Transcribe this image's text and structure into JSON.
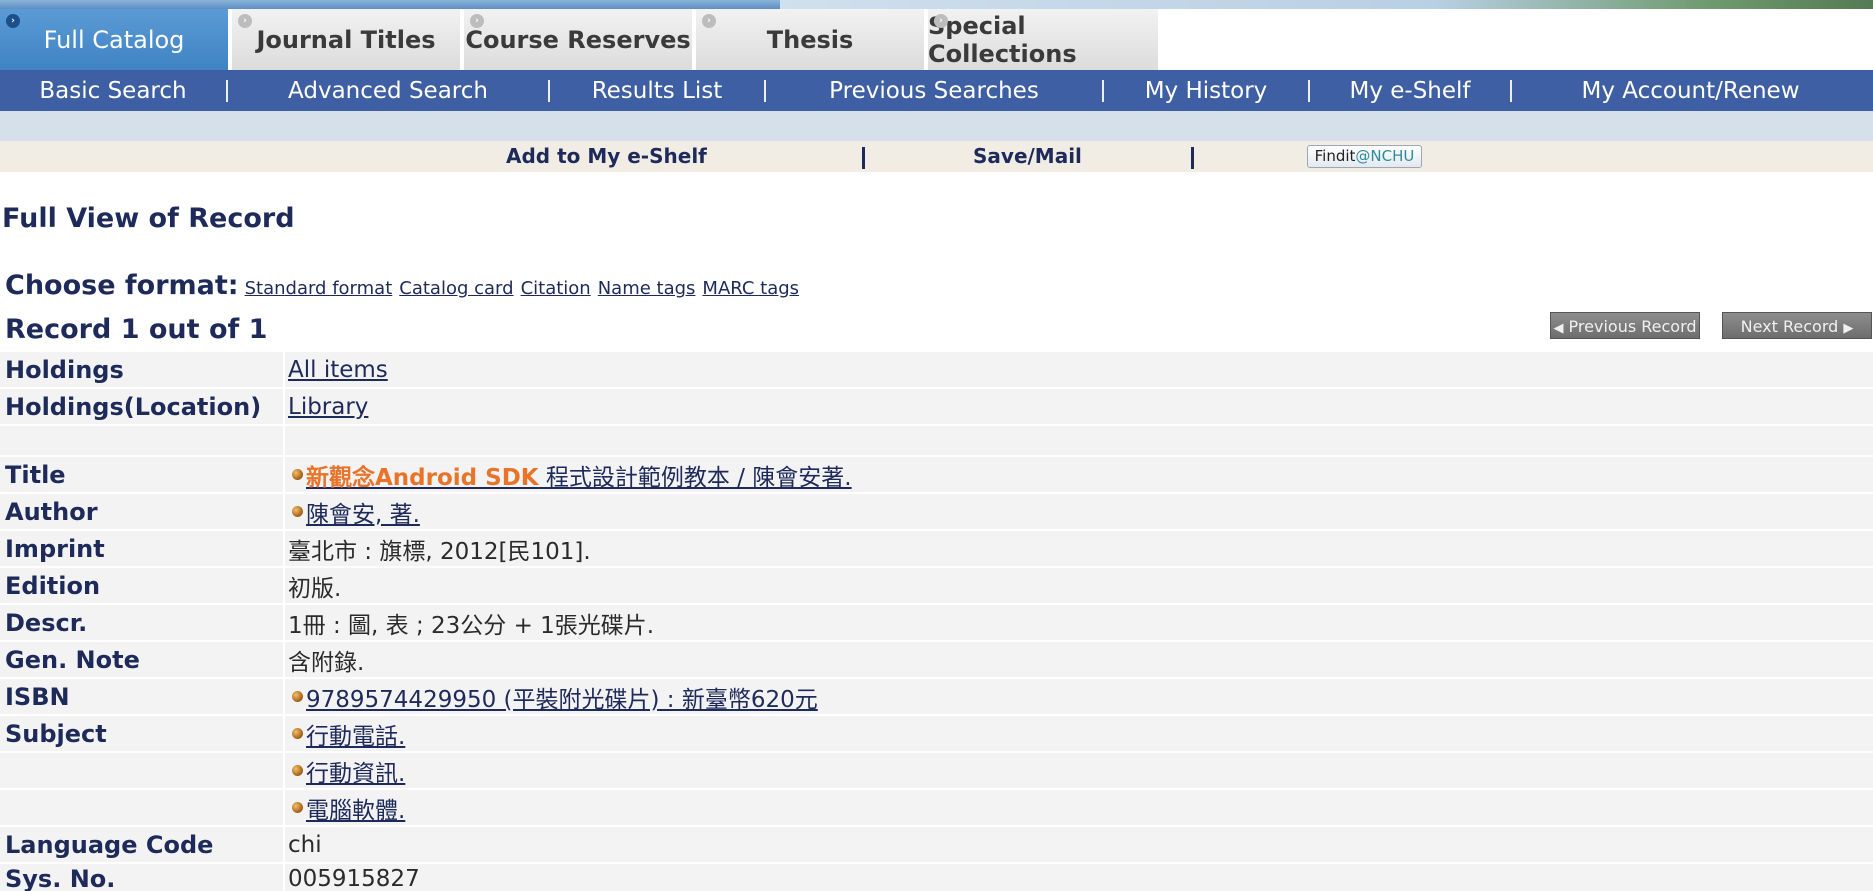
{
  "tabs": [
    {
      "label": "Full Catalog",
      "active": true
    },
    {
      "label": "Journal Titles",
      "active": false
    },
    {
      "label": "Course Reserves",
      "active": false
    },
    {
      "label": "Thesis",
      "active": false
    },
    {
      "label": "Special Collections",
      "active": false
    }
  ],
  "nav": [
    "Basic Search",
    "Advanced Search",
    "Results List",
    "Previous Searches",
    "My History",
    "My e-Shelf",
    "My Account/Renew"
  ],
  "actions": {
    "add_shelf": "Add to My e-Shelf",
    "save_mail": "Save/Mail",
    "findit_prefix": "Findit",
    "findit_suffix": "@NCHU"
  },
  "page_title": "Full View of Record",
  "format": {
    "label": "Choose format:",
    "links": [
      "Standard format",
      "Catalog card",
      "Citation",
      "Name tags",
      "MARC tags"
    ]
  },
  "record_count": "Record 1 out of 1",
  "record_nav": {
    "prev": "Previous Record",
    "next": "Next Record"
  },
  "record": {
    "holdings_label": "Holdings",
    "holdings_value": "All items",
    "location_label": "Holdings(Location)",
    "location_value": "Library",
    "title_label": "Title",
    "title_kw1": "新觀念",
    "title_kw2": "Android SDK",
    "title_rest": " 程式設計範例教本 / 陳會安著.",
    "author_label": "Author",
    "author_value": "陳會安, 著.",
    "imprint_label": "Imprint",
    "imprint_value": "臺北市 : 旗標, 2012[民101].",
    "edition_label": "Edition",
    "edition_value": "初版.",
    "descr_label": "Descr.",
    "descr_value": "1冊 :  圖, 表 ;  23公分 +  1張光碟片.",
    "gennote_label": "Gen. Note",
    "gennote_value": "含附錄.",
    "isbn_label": "ISBN",
    "isbn_value": "9789574429950 (平裝附光碟片) : 新臺幣620元",
    "subject_label": "Subject",
    "subjects": [
      "行動電話.",
      "行動資訊.",
      "電腦軟體."
    ],
    "lang_label": "Language Code",
    "lang_value": "chi",
    "sysno_label": "Sys. No.",
    "sysno_value": "005915827"
  }
}
